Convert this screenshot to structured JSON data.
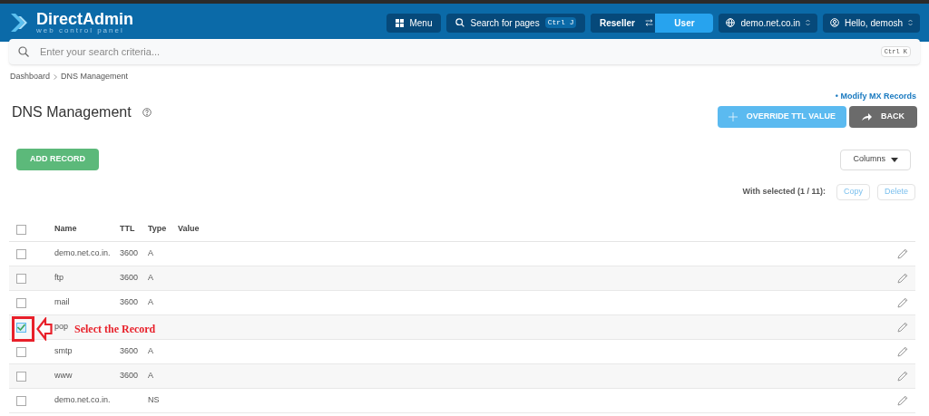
{
  "header": {
    "logo_title": "DirectAdmin",
    "logo_subtitle": "web control panel",
    "menu_button": "Menu",
    "page_search": {
      "label": "Search for pages",
      "shortcut": "Ctrl J"
    },
    "level_switch": [
      {
        "label": "Reseller",
        "selected": false
      },
      {
        "label": "User",
        "selected": true
      }
    ],
    "domain_selector": "demo.net.co.in",
    "user_menu": "Hello, demosh"
  },
  "search": {
    "placeholder": "Enter your search criteria...",
    "shortcut": "Ctrl K"
  },
  "breadcrumb": [
    "Dashboard",
    "DNS Management"
  ],
  "page_title": "DNS Management",
  "modify_mx_link": "• Modify MX Records",
  "actions": [
    {
      "label": "OVERRIDE TTL VALUE",
      "kind": "override"
    },
    {
      "label": "BACK",
      "kind": "back"
    }
  ],
  "add_record_button": "ADD RECORD",
  "columns_button": "Columns",
  "with_selected": {
    "label": "With selected (1 / 11):",
    "buttons": [
      "Copy",
      "Delete"
    ]
  },
  "table": {
    "columns": [
      "Name",
      "TTL",
      "Type",
      "Value"
    ],
    "header_checked": false,
    "rows": [
      {
        "name": "demo.net.co.in.",
        "ttl": "3600",
        "type": "A",
        "checked": false
      },
      {
        "name": "ftp",
        "ttl": "3600",
        "type": "A",
        "checked": false
      },
      {
        "name": "mail",
        "ttl": "3600",
        "type": "A",
        "checked": false
      },
      {
        "name": "pop",
        "checked": true
      },
      {
        "name": "smtp",
        "ttl": "3600",
        "type": "A",
        "checked": false
      },
      {
        "name": "www",
        "ttl": "3600",
        "type": "A",
        "checked": false
      },
      {
        "name": "demo.net.co.in.",
        "type": "NS",
        "checked": false
      }
    ]
  },
  "annotation": {
    "text": "Select the Record"
  }
}
